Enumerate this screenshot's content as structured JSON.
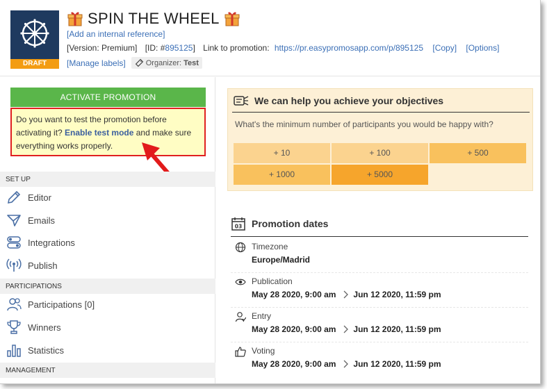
{
  "header": {
    "title": "SPIN THE WHEEL",
    "badge": "DRAFT",
    "internal_reference": "[Add an internal reference]",
    "version": "[Version: Premium]",
    "id_prefix": "[ID: #",
    "id_value": "895125",
    "id_suffix": "]",
    "link_label": "Link to promotion:",
    "link_url": "https://pr.easypromosapp.com/p/895125",
    "copy": "[Copy]",
    "options": "[Options]",
    "manage_labels": "[Manage labels]",
    "organizer_label": "Organizer:",
    "organizer_value": "Test"
  },
  "left": {
    "activate_button": "ACTIVATE PROMOTION",
    "test_text_before": "Do you want to test the promotion before activating it?",
    "test_link": "Enable test mode",
    "test_text_after": "and make sure everything works properly.",
    "sections": {
      "setup": "SET UP",
      "participations": "PARTICIPATIONS",
      "management": "MANAGEMENT"
    },
    "nav": {
      "editor": "Editor",
      "emails": "Emails",
      "integrations": "Integrations",
      "publish": "Publish",
      "participations": "Participations [0]",
      "winners": "Winners",
      "statistics": "Statistics"
    }
  },
  "objectives": {
    "title": "We can help you achieve your objectives",
    "question": "What's the minimum number of participants you would be happy with?",
    "options": [
      "+ 10",
      "+ 100",
      "+ 500",
      "+ 1000",
      "+ 5000"
    ]
  },
  "dates": {
    "title": "Promotion dates",
    "calendar_day": "03",
    "timezone_label": "Timezone",
    "timezone_value": "Europe/Madrid",
    "publication_label": "Publication",
    "publication_start": "May 28 2020, 9:00 am",
    "publication_end": "Jun 12 2020, 11:59 pm",
    "entry_label": "Entry",
    "entry_start": "May 28 2020, 9:00 am",
    "entry_end": "Jun 12 2020, 11:59 pm",
    "voting_label": "Voting",
    "voting_start": "May 28 2020, 9:00 am",
    "voting_end": "Jun 12 2020, 11:59 pm"
  },
  "icons": {
    "logo": "spin-wheel-icon",
    "gift": "gift-icon",
    "tag": "tag-icon",
    "editor": "pencil-icon",
    "emails": "paper-plane-icon",
    "integrations": "toggles-icon",
    "publish": "broadcast-icon",
    "participations": "users-icon",
    "winners": "trophy-icon",
    "statistics": "bar-chart-icon",
    "objectives": "target-card-icon",
    "calendar": "calendar-icon",
    "timezone": "globe-icon",
    "publication": "eye-icon",
    "entry": "user-icon",
    "voting": "thumbs-up-icon",
    "arrow": "red-arrow-icon"
  },
  "colors": {
    "brand_navy": "#1f3a5f",
    "draft_orange": "#f39c12",
    "activate_green": "#5ab64a",
    "test_box_bg": "#fffdc4",
    "test_box_border": "#e02020",
    "link_blue": "#3b6fb6",
    "objectives_bg": "#fdf0d6",
    "option_light": "#fbd38f",
    "option_medium": "#f9c15d",
    "option_dark": "#f6a52c"
  }
}
